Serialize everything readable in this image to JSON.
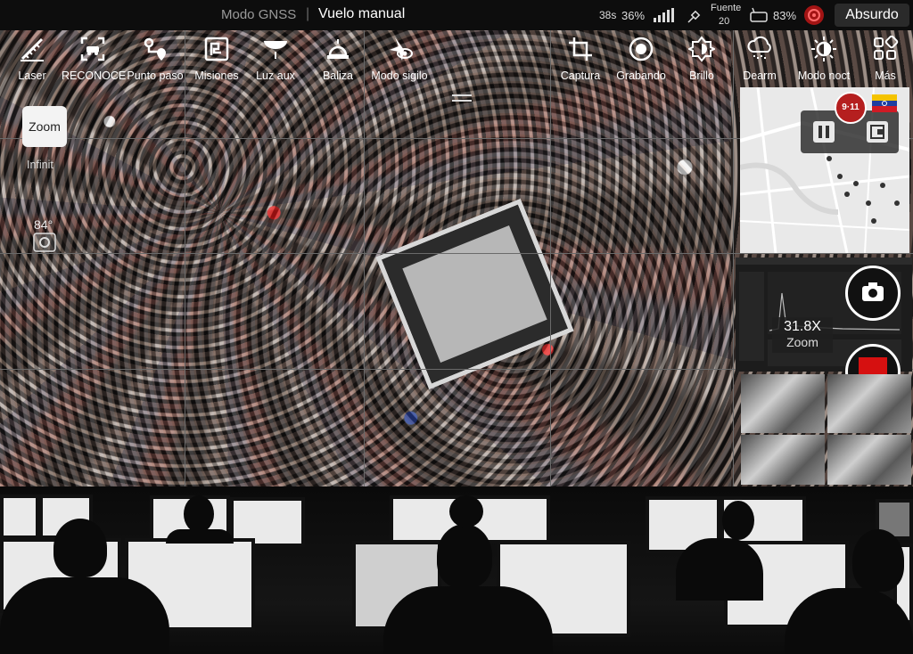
{
  "status_bar": {
    "gnss_mode": "Modo GNSS",
    "separator": "|",
    "flight_mode": "Vuelo manual",
    "time_left": "38s",
    "battery_pct": "36%",
    "source_label": "Fuente",
    "source_value": "20",
    "remote_battery": "83%",
    "mode_button": "Absurdo"
  },
  "toolbar": {
    "left": [
      {
        "label": "Laser",
        "icon": "laser-ruler-icon"
      },
      {
        "label": "RECONOCE",
        "icon": "vehicle-scan-icon"
      },
      {
        "label": "Punto paso",
        "icon": "waypoint-icon"
      },
      {
        "label": "Misiones",
        "icon": "missions-icon"
      },
      {
        "label": "Luz aux",
        "icon": "aux-light-icon"
      },
      {
        "label": "Baliza",
        "icon": "beacon-icon"
      },
      {
        "label": "Modo sigilo",
        "icon": "stealth-icon"
      }
    ],
    "right": [
      {
        "label": "Captura",
        "icon": "crop-icon"
      },
      {
        "label": "Grabando",
        "icon": "record-icon"
      },
      {
        "label": "Brillo",
        "icon": "brightness-icon"
      },
      {
        "label": "Dearm",
        "icon": "defog-icon"
      },
      {
        "label": "Modo noct",
        "icon": "night-mode-icon"
      },
      {
        "label": "Más",
        "icon": "more-grid-icon"
      }
    ]
  },
  "left_controls": {
    "zoom_button": "Zoom",
    "focus_label": "Infinit",
    "gimbal_angle": "84°"
  },
  "map": {
    "badge": "9·11"
  },
  "zoom_readout": {
    "value": "31.8X",
    "label": "Zoom"
  },
  "colors": {
    "record_red": "#d61010",
    "badge_red": "#b51f1f",
    "status_bg": "#0d0d0d"
  }
}
